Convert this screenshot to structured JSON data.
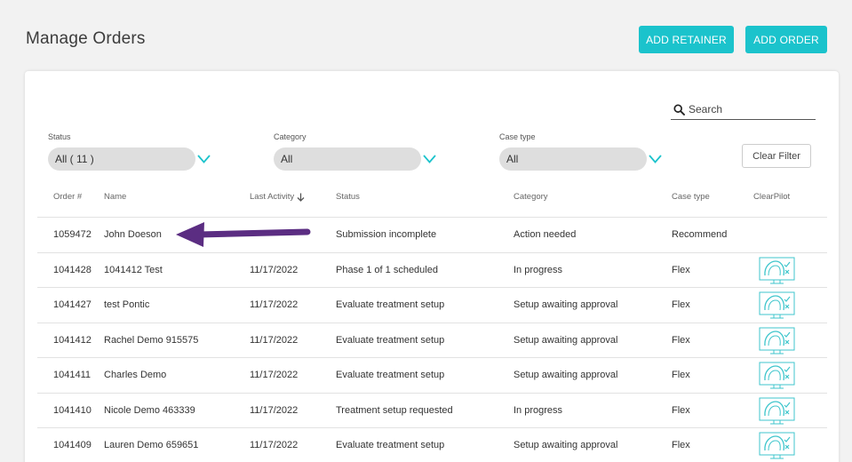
{
  "page": {
    "title": "Manage Orders"
  },
  "actions": {
    "add_retainer": "ADD RETAINER",
    "add_order": "ADD ORDER"
  },
  "search": {
    "label": "Search"
  },
  "filters": {
    "status": {
      "label": "Status",
      "value": "All ( 11 )"
    },
    "category": {
      "label": "Category",
      "value": "All"
    },
    "case_type": {
      "label": "Case type",
      "value": "All"
    },
    "clear": "Clear Filter"
  },
  "table": {
    "headers": {
      "order": "Order #",
      "name": "Name",
      "last_activity": "Last Activity",
      "status": "Status",
      "category": "Category",
      "case_type": "Case type",
      "clearpilot": "ClearPilot"
    },
    "rows": [
      {
        "order": "1059472",
        "name": "John Doeson",
        "last_activity": "",
        "status": "Submission incomplete",
        "category": "Action needed",
        "case_type": "Recommend",
        "clearpilot": false
      },
      {
        "order": "1041428",
        "name": "1041412 Test",
        "last_activity": "11/17/2022",
        "status": "Phase 1 of 1 scheduled",
        "category": "In progress",
        "case_type": "Flex",
        "clearpilot": true
      },
      {
        "order": "1041427",
        "name": "test Pontic",
        "last_activity": "11/17/2022",
        "status": "Evaluate treatment setup",
        "category": "Setup awaiting approval",
        "case_type": "Flex",
        "clearpilot": true
      },
      {
        "order": "1041412",
        "name": "Rachel Demo 915575",
        "last_activity": "11/17/2022",
        "status": "Evaluate treatment setup",
        "category": "Setup awaiting approval",
        "case_type": "Flex",
        "clearpilot": true
      },
      {
        "order": "1041411",
        "name": "Charles Demo",
        "last_activity": "11/17/2022",
        "status": "Evaluate treatment setup",
        "category": "Setup awaiting approval",
        "case_type": "Flex",
        "clearpilot": true
      },
      {
        "order": "1041410",
        "name": "Nicole Demo 463339",
        "last_activity": "11/17/2022",
        "status": "Treatment setup requested",
        "category": "In progress",
        "case_type": "Flex",
        "clearpilot": true
      },
      {
        "order": "1041409",
        "name": "Lauren Demo 659651",
        "last_activity": "11/17/2022",
        "status": "Evaluate treatment setup",
        "category": "Setup awaiting approval",
        "case_type": "Flex",
        "clearpilot": true
      }
    ]
  },
  "icons": {
    "search": "search-icon",
    "chevron": "chevron-down-icon",
    "sort": "sort-arrow-down-icon",
    "clearpilot": "clearpilot-monitor-icon",
    "arrow": "annotation-arrow-icon"
  },
  "colors": {
    "accent": "#1bc3cc",
    "annotation_arrow": "#5b2d82",
    "select_bg": "#dedede"
  }
}
